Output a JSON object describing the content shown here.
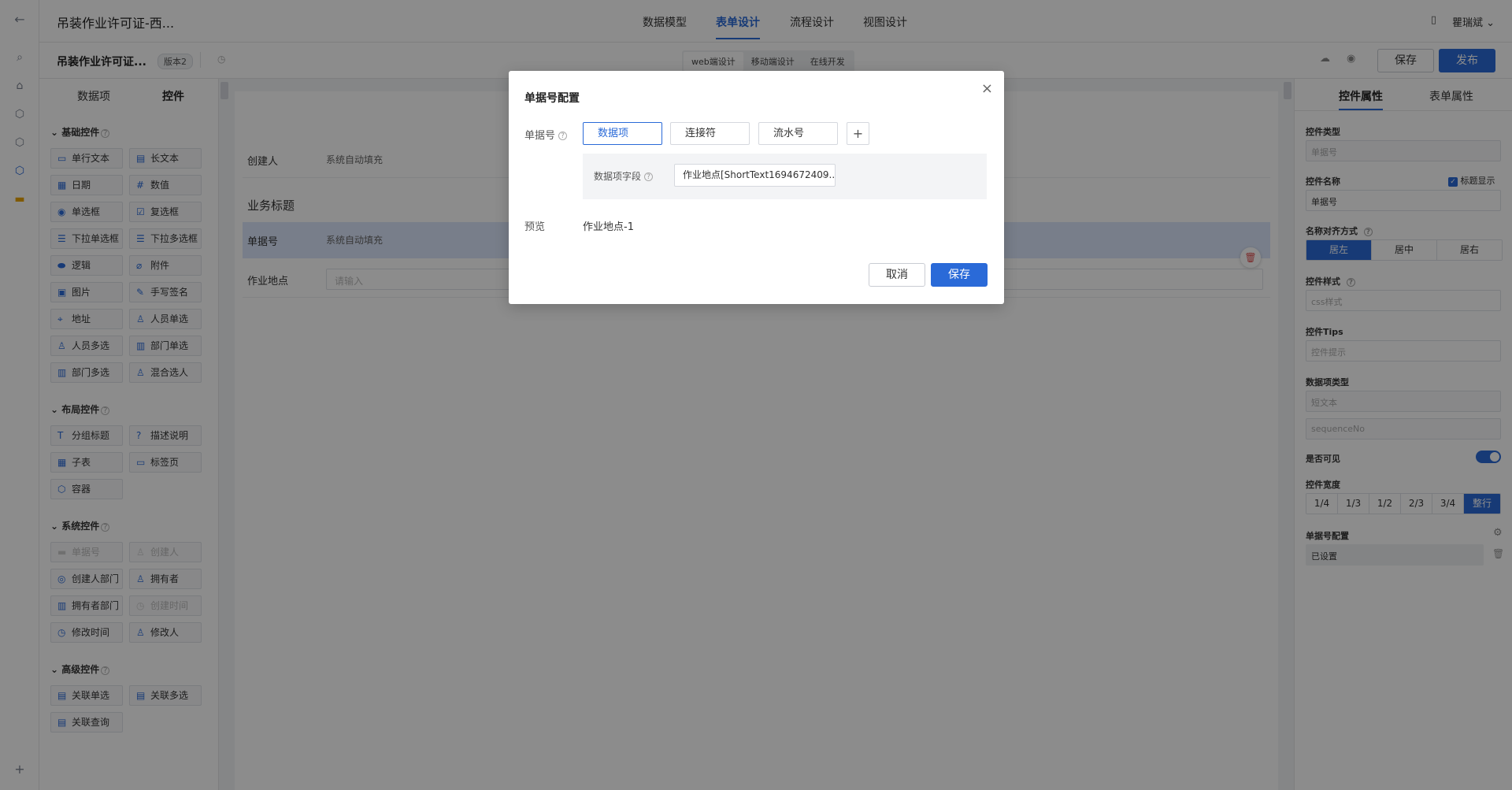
{
  "topbar": {
    "app_title": "吊装作业许可证-西...",
    "tabs": [
      "数据模型",
      "表单设计",
      "流程设计",
      "视图设计"
    ],
    "active_tab": "表单设计",
    "user_name": "瞿瑞斌"
  },
  "subbar": {
    "form_name": "吊装作业许可证...",
    "version_badge": "版本2",
    "modes": [
      "web端设计",
      "移动端设计",
      "在线开发"
    ],
    "save_label": "保存",
    "publish_label": "发布"
  },
  "left_panel": {
    "tabs": [
      "数据项",
      "控件"
    ],
    "groups": [
      {
        "title": "基础控件",
        "items": [
          "单行文本",
          "长文本",
          "日期",
          "数值",
          "单选框",
          "复选框",
          "下拉单选框",
          "下拉多选框",
          "逻辑",
          "附件",
          "图片",
          "手写签名",
          "地址",
          "人员单选",
          "人员多选",
          "部门单选",
          "部门多选",
          "混合选人"
        ]
      },
      {
        "title": "布局控件",
        "items": [
          "分组标题",
          "描述说明",
          "子表",
          "标签页",
          "容器"
        ]
      },
      {
        "title": "系统控件",
        "items": [
          "单据号",
          "创建人",
          "创建人部门",
          "拥有者",
          "拥有者部门",
          "创建时间",
          "修改时间",
          "修改人"
        ]
      },
      {
        "title": "高级控件",
        "items": [
          "关联单选",
          "关联多选",
          "关联查询"
        ]
      }
    ]
  },
  "canvas": {
    "creator_label": "创建人",
    "creator_value": "系统自动填充",
    "section_title": "业务标题",
    "doc_no_label": "单据号",
    "doc_no_value": "系统自动填充",
    "location_label": "作业地点",
    "location_placeholder": "请输入"
  },
  "right_panel": {
    "tabs": [
      "控件属性",
      "表单属性"
    ],
    "control_type_label": "控件类型",
    "control_type_value": "单据号",
    "control_name_label": "控件名称",
    "show_title_label": "标题显示",
    "control_name_value": "单据号",
    "align_label": "名称对齐方式",
    "align_options": [
      "居左",
      "居中",
      "居右"
    ],
    "style_label": "控件样式",
    "style_placeholder": "css样式",
    "tips_label": "控件Tips",
    "tips_placeholder": "控件提示",
    "data_type_label": "数据项类型",
    "data_type_value": "短文本",
    "data_code_value": "sequenceNo",
    "visible_label": "是否可见",
    "width_label": "控件宽度",
    "width_options": [
      "1/4",
      "1/3",
      "1/2",
      "2/3",
      "3/4",
      "整行"
    ],
    "doc_config_label": "单据号配置",
    "doc_config_value": "已设置"
  },
  "modal": {
    "title": "单据号配置",
    "field_label": "单据号",
    "chips": [
      "数据项",
      "连接符",
      "流水号"
    ],
    "data_field_label": "数据项字段",
    "data_field_value": "作业地点[ShortText1694672409...",
    "preview_label": "预览",
    "preview_value": "作业地点-1",
    "cancel_label": "取消",
    "save_label": "保存"
  }
}
